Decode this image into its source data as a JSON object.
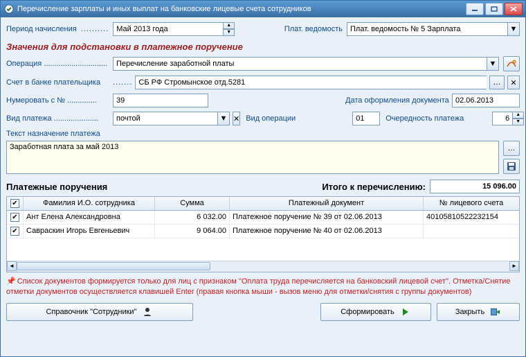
{
  "window": {
    "title": "Перечисление зарплаты и иных выплат на банковские лицевые счета сотрудников"
  },
  "top": {
    "period_label": "Период начисления",
    "period_value": "Май 2013 года",
    "vedomost_label": "Плат. ведомость",
    "vedomost_value": "Плат. ведомость № 5 Зарплата"
  },
  "section1_title": "Значения для подстановки в платежное поручение",
  "operation": {
    "label": "Операция",
    "value": "Перечисление заработной платы"
  },
  "bank": {
    "label": "Счет в банке плательщика",
    "value": "СБ РФ Стромынское отд.5281"
  },
  "number_from": {
    "label": "Нумеровать с №",
    "value": "39"
  },
  "doc_date": {
    "label": "Дата оформления документа",
    "value": "02.06.2013"
  },
  "payment_kind": {
    "label": "Вид платежа",
    "value": "почтой"
  },
  "oper_kind": {
    "label": "Вид операции",
    "value": "01"
  },
  "priority": {
    "label": "Очередность платежа",
    "value": "6"
  },
  "purpose": {
    "label": "Текст назначение платежа",
    "value": "Заработная плата за май 2013"
  },
  "orders": {
    "title": "Платежные поручения",
    "total_label": "Итого к перечислению:",
    "total_value": "15 096.00",
    "columns": {
      "name": "Фамилия И.О. сотрудника",
      "sum": "Сумма",
      "doc": "Платежный документ",
      "acc": "№ лицевого счета"
    },
    "rows": [
      {
        "checked": true,
        "name": "Ант Елена Александровна",
        "sum": "6 032.00",
        "doc": "Платежное поручение № 39 от 02.06.2013",
        "acc": "40105810522232154"
      },
      {
        "checked": true,
        "name": "Савраскин Игорь Евгеньевич",
        "sum": "9 064.00",
        "doc": "Платежное поручение № 40 от 02.06.2013",
        "acc": ""
      }
    ]
  },
  "hint": "Список документов формируется только для лиц с признаком \"Оплата труда перечисляется на банковский лицевой счет\". Отметка/Снятие отметки документов осуществляется клавишей Enter (правая кнопка мыши - вызов меню для отметки/снятия с группы документов)",
  "buttons": {
    "employees": "Справочник \"Сотрудники\"",
    "form": "Сформировать",
    "close": "Закрыть"
  }
}
